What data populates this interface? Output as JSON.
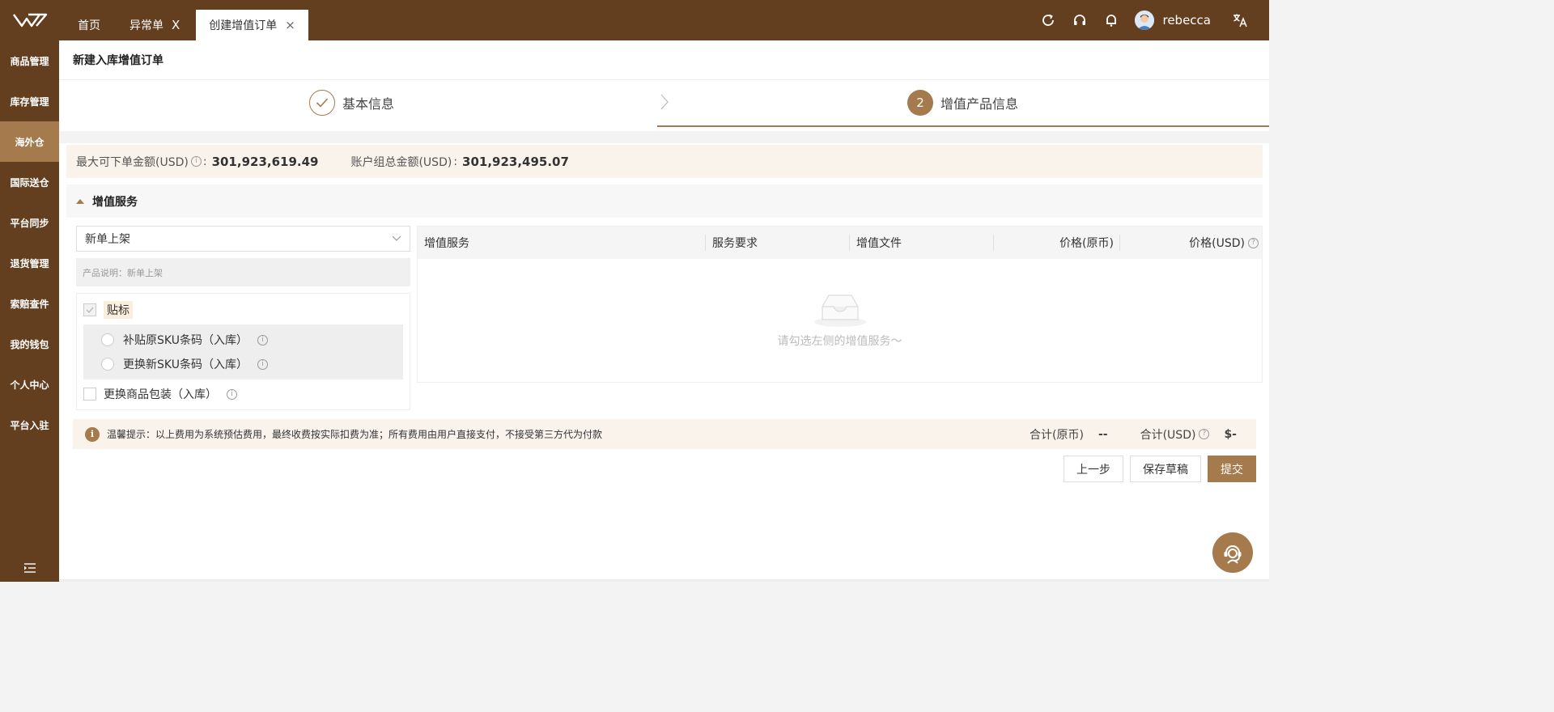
{
  "header": {
    "tabs": [
      {
        "label": "首页",
        "closable": false
      },
      {
        "label": "异常单",
        "closable": true,
        "close_glyph": "X"
      },
      {
        "label": "创建增值订单",
        "closable": true,
        "close_glyph": "×",
        "active": true
      }
    ],
    "username": "rebecca",
    "icons": [
      "refresh-icon",
      "headset-icon",
      "bell-icon",
      "translate-icon"
    ]
  },
  "sidebar": {
    "items": [
      {
        "label": "商品管理"
      },
      {
        "label": "库存管理"
      },
      {
        "label": "海外仓",
        "active": true
      },
      {
        "label": "国际送仓"
      },
      {
        "label": "平台同步"
      },
      {
        "label": "退货管理"
      },
      {
        "label": "索赔查件"
      },
      {
        "label": "我的钱包"
      },
      {
        "label": "个人中心"
      },
      {
        "label": "平台入驻"
      }
    ]
  },
  "page": {
    "title": "新建入库增值订单"
  },
  "steps": {
    "step1_label": "基本信息",
    "step2_number": "2",
    "step2_label": "增值产品信息"
  },
  "amounts": {
    "max_label": "最大可下单金额(USD)",
    "max_sep": ":",
    "max_value": "301,923,619.49",
    "group_label": "账户组总金额(USD)",
    "group_sep": ":",
    "group_value": "301,923,495.07"
  },
  "section": {
    "title": "增值服务"
  },
  "left": {
    "select_value": "新单上架",
    "description": "产品说明：新单上架",
    "tag_option": "贴标",
    "sub_options": [
      "补贴原SKU条码（入库）",
      "更换新SKU条码（入库）"
    ],
    "package_option": "更换商品包装（入库）"
  },
  "table": {
    "headers": [
      "增值服务",
      "服务要求",
      "增值文件",
      "价格(原币)",
      "价格(USD)"
    ],
    "empty_text": "请勾选左侧的增值服务～"
  },
  "tip": {
    "icon_glyph": "i",
    "text": "温馨提示：以上费用为系统预估费用，最终收费按实际扣费为准；所有费用由用户直接支付，不接受第三方代为付款",
    "total_original_label": "合计(原币)",
    "total_original_value": "--",
    "total_usd_label": "合计(USD)",
    "total_usd_value": "$-"
  },
  "actions": {
    "prev": "上一步",
    "save_draft": "保存草稿",
    "submit": "提交"
  },
  "colors": {
    "brand_dark": "#633f1f",
    "accent": "#a57a4c",
    "highlight_bg": "#faf3ec"
  }
}
